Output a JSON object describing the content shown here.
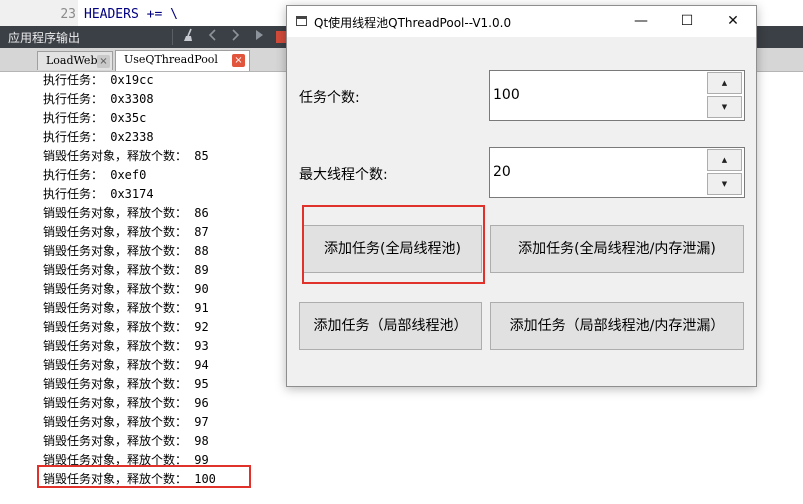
{
  "editor": {
    "line_number": "23",
    "code": "HEADERS += \\"
  },
  "output_pane": {
    "title": "应用程序输出",
    "tabs": [
      {
        "label": "LoadWeb",
        "close": "×"
      },
      {
        "label": "UseQThreadPool",
        "close": "×"
      }
    ],
    "toolbar_icons": [
      "broom-icon",
      "chevron-left-icon",
      "chevron-right-icon",
      "play-icon",
      "stop-icon"
    ],
    "lines": [
      "执行任务： 0x19cc",
      "执行任务： 0x3308",
      "执行任务： 0x35c",
      "执行任务： 0x2338",
      "销毁任务对象，释放个数： 85",
      "执行任务： 0xef0",
      "执行任务： 0x3174",
      "销毁任务对象，释放个数： 86",
      "销毁任务对象，释放个数： 87",
      "销毁任务对象，释放个数： 88",
      "销毁任务对象，释放个数： 89",
      "销毁任务对象，释放个数： 90",
      "销毁任务对象，释放个数： 91",
      "销毁任务对象，释放个数： 92",
      "销毁任务对象，释放个数： 93",
      "销毁任务对象，释放个数： 94",
      "销毁任务对象，释放个数： 95",
      "销毁任务对象，释放个数： 96",
      "销毁任务对象，释放个数： 97",
      "销毁任务对象，释放个数： 98",
      "销毁任务对象，释放个数： 99",
      "销毁任务对象，释放个数： 100"
    ]
  },
  "dialog": {
    "title": "Qt使用线程池QThreadPool--V1.0.0",
    "controls": {
      "minimize": "—",
      "maximize": "☐",
      "close": "✕"
    },
    "task_count": {
      "label": "任务个数:",
      "value": "100"
    },
    "max_threads": {
      "label": "最大线程个数:",
      "value": "20"
    },
    "spin_up": "▲",
    "spin_down": "▼",
    "buttons": {
      "add_global": "添加任务(全局线程池)",
      "add_global_leak": "添加任务(全局线程池/内存泄漏)",
      "add_local": "添加任务（局部线程池）",
      "add_local_leak": "添加任务（局部线程池/内存泄漏）"
    }
  },
  "colors": {
    "highlight": "#e0322b",
    "toolbar": "#3b4046"
  }
}
